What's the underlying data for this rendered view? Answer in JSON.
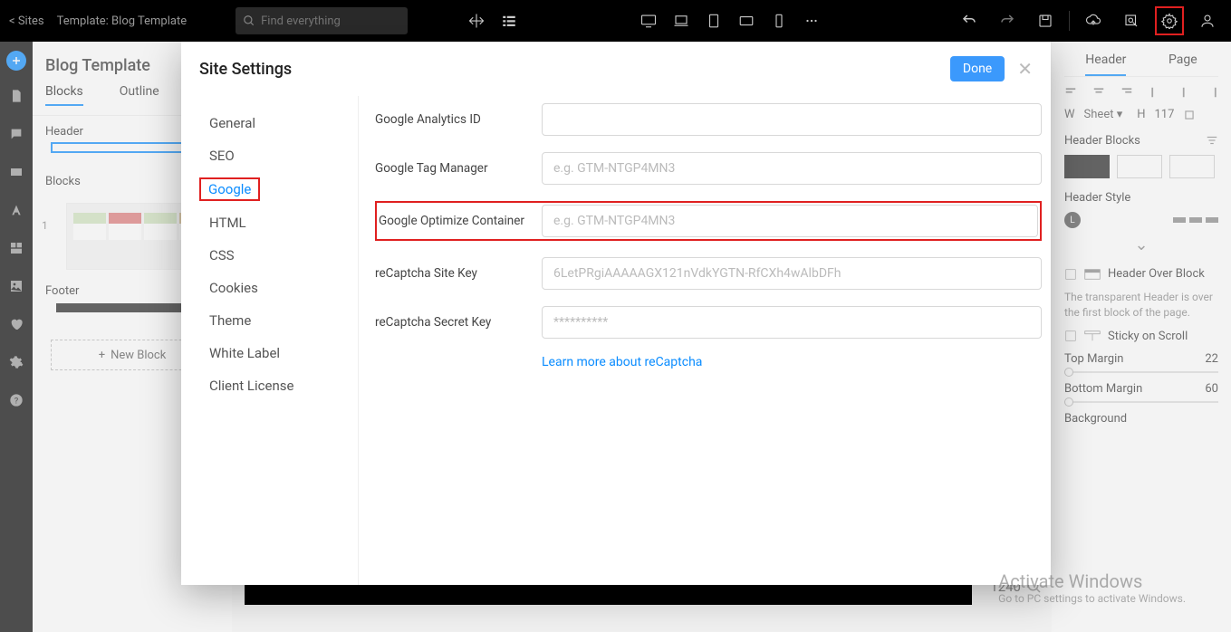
{
  "topbar": {
    "sites": "< Sites",
    "template": "Template: Blog Template",
    "search_placeholder": "Find everything"
  },
  "left_panel": {
    "title": "Blog Template",
    "tabs": {
      "blocks": "Blocks",
      "outline": "Outline"
    },
    "header_label": "Header",
    "blocks_label": "Blocks",
    "block_num": "1",
    "footer_label": "Footer",
    "new_block": "New Block"
  },
  "right_panel": {
    "tabs": {
      "header": "Header",
      "page": "Page"
    },
    "width_label": "W",
    "width_mode": "Sheet",
    "height_label": "H",
    "height_value": "117",
    "section_blocks": "Header Blocks",
    "section_style": "Header Style",
    "style_letter": "L",
    "header_over_block": "Header Over Block",
    "header_over_desc": "The transparent Header is over the first block of the page.",
    "sticky": "Sticky on Scroll",
    "top_margin_label": "Top Margin",
    "top_margin_val": "22",
    "bottom_margin_label": "Bottom Margin",
    "bottom_margin_val": "60",
    "background_label": "Background"
  },
  "canvas": {
    "zoom": "1240"
  },
  "modal": {
    "title": "Site Settings",
    "done": "Done",
    "nav": {
      "general": "General",
      "seo": "SEO",
      "google": "Google",
      "html": "HTML",
      "css": "CSS",
      "cookies": "Cookies",
      "theme": "Theme",
      "white_label": "White Label",
      "client_license": "Client License"
    },
    "form": {
      "ga_label": "Google Analytics ID",
      "gtm_label": "Google Tag Manager",
      "gtm_ph": "e.g. GTM-NTGP4MN3",
      "optimize_label": "Google Optimize Container",
      "optimize_ph": "e.g. GTM-NTGP4MN3",
      "recaptcha_site_label": "reCaptcha Site Key",
      "recaptcha_site_ph": "6LetPRgiAAAAAGX121nVdkYGTN-RfCXh4wAlbDFh",
      "recaptcha_secret_label": "reCaptcha Secret Key",
      "recaptcha_secret_ph": "**********",
      "learn_more": "Learn more about reCaptcha"
    }
  },
  "watermark": {
    "l1": "Activate Windows",
    "l2": "Go to PC settings to activate Windows."
  }
}
